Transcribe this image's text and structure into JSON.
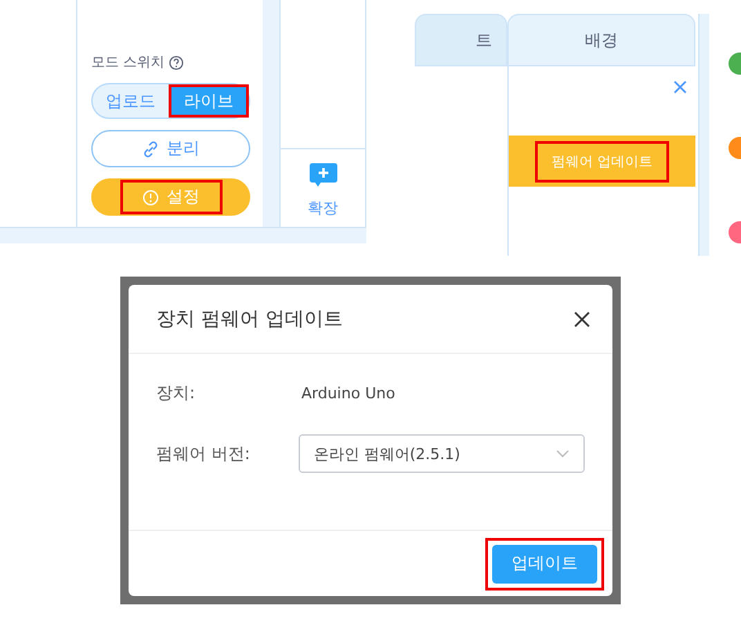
{
  "mode_panel": {
    "label": "모드 스위치",
    "modes": [
      {
        "label": "업로드",
        "selected": false,
        "highlighted": false
      },
      {
        "label": "라이브",
        "selected": true,
        "highlighted": true
      }
    ],
    "disconnect_button": {
      "label": "분리",
      "highlighted": false
    },
    "settings_button": {
      "label": "설정",
      "highlighted": true
    },
    "extension_button": {
      "label": "확장"
    }
  },
  "tabs": [
    {
      "label": "트",
      "selected": false
    },
    {
      "label": "배경",
      "selected": true
    }
  ],
  "firmware_menu": {
    "item": "펌웨어 업데이트",
    "highlighted": true
  },
  "side_dots": [
    {
      "color": "#4caf50"
    },
    {
      "color": "#ff8c1a"
    },
    {
      "color": "#ff6680"
    }
  ],
  "dialog": {
    "title": "장치 펌웨어 업데이트",
    "fields": [
      {
        "kind": "text",
        "label": "장치:",
        "value": "Arduino Uno"
      },
      {
        "kind": "select",
        "label": "펌웨어 버전:",
        "value": "온라인 펌웨어(2.5.1)"
      }
    ],
    "button": {
      "label": "업데이트",
      "highlighted": true
    }
  }
}
